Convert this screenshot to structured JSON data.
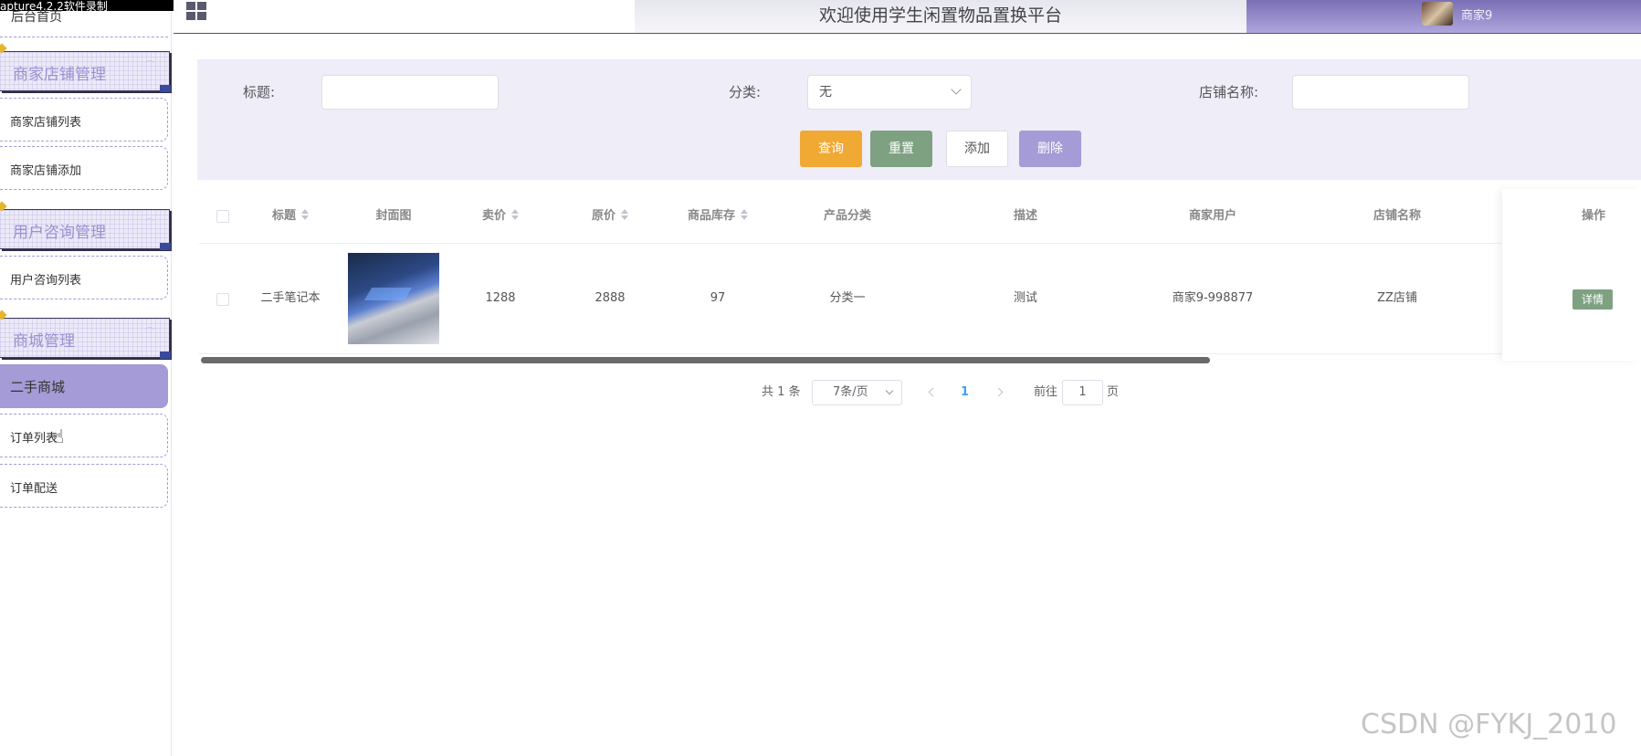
{
  "capture_text": "apture4.2.2软件录制",
  "header": {
    "title": "欢迎使用学生闲置物品置换平台",
    "username": "商家9"
  },
  "sidebar": {
    "home": "后台首页",
    "groups": [
      {
        "label": "商家店铺管理",
        "items": [
          "商家店铺列表",
          "商家店铺添加"
        ]
      },
      {
        "label": "用户咨询管理",
        "items": [
          "用户咨询列表"
        ]
      },
      {
        "label": "商城管理",
        "items": [
          "二手商城",
          "订单列表",
          "订单配送"
        ]
      }
    ],
    "active_item": "二手商城"
  },
  "search": {
    "title_label": "标题:",
    "title_value": "",
    "category_label": "分类:",
    "category_value": "无",
    "shop_label": "店铺名称:",
    "shop_value": "",
    "query_button": "查询",
    "reset_button": "重置",
    "add_button": "添加",
    "delete_button": "删除"
  },
  "table": {
    "columns": [
      "标题",
      "封面图",
      "卖价",
      "原价",
      "商品库存",
      "产品分类",
      "描述",
      "商家用户",
      "店铺名称",
      "操作"
    ],
    "rows": [
      {
        "title": "二手笔记本",
        "sale_price": "1288",
        "original_price": "2888",
        "stock": "97",
        "category": "分类一",
        "description": "测试",
        "merchant": "商家9-998877",
        "shop": "ZZ店铺",
        "action": "详情"
      }
    ]
  },
  "pagination": {
    "total": "共 1 条",
    "page_size": "7条/页",
    "current_page": "1",
    "goto_label": "前往",
    "goto_value": "1",
    "page_suffix": "页"
  },
  "watermark": "CSDN @FYKJ_2010",
  "colors": {
    "accent": "#a59bd6",
    "query": "#f0a933",
    "reset": "#7ea182",
    "search_bg": "#efedf7"
  }
}
